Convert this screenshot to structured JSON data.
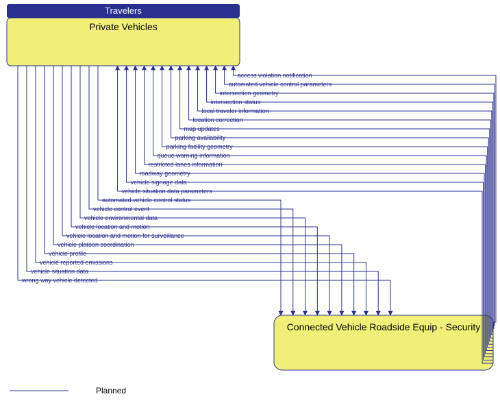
{
  "top_node": {
    "header": "Travelers",
    "title": "Private Vehicles"
  },
  "bottom_node": {
    "title": "Connected Vehicle Roadside Equip - Security"
  },
  "legend": {
    "planned": "Planned"
  },
  "flows_up": [
    "access violation notification",
    "automated vehicle control parameters",
    "intersection geometry",
    "intersection status",
    "local traveler information",
    "location correction",
    "map updates",
    "parking availability",
    "parking facility geometry",
    "queue warning information",
    "restricted lanes information",
    "roadway geometry",
    "vehicle signage data",
    "vehicle situation data parameters"
  ],
  "flows_down": [
    "automated vehicle control status",
    "vehicle control event",
    "vehicle environmental data",
    "vehicle location and motion",
    "vehicle location and motion for surveillance",
    "vehicle platoon coordination",
    "vehicle profile",
    "vehicle reported emissions",
    "vehicle situation data",
    "wrong way vehicle detected"
  ]
}
